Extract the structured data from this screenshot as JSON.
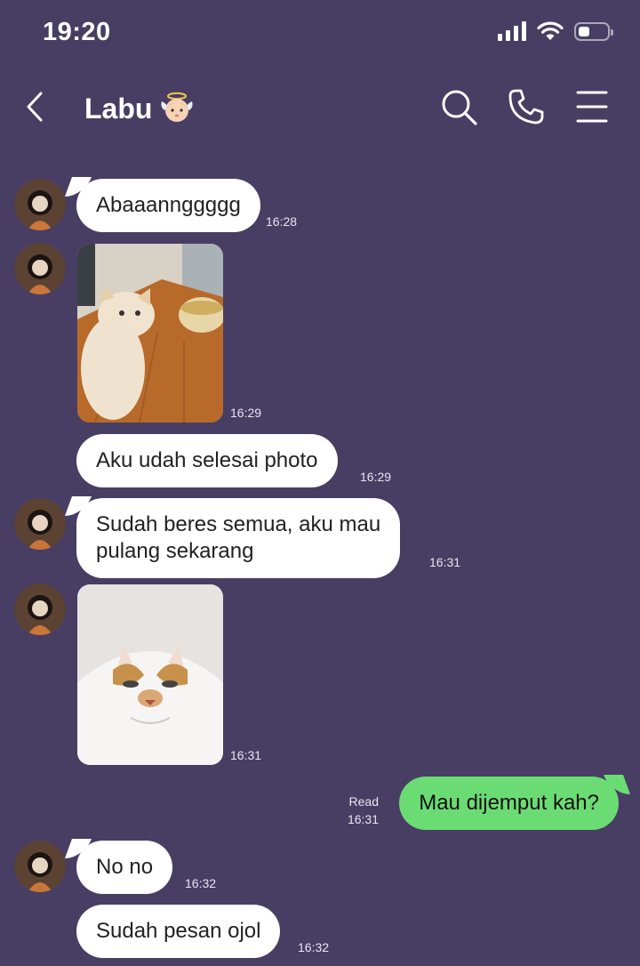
{
  "status": {
    "time": "19:20",
    "battery_level": 0.4
  },
  "header": {
    "title": "Labu",
    "title_emoji": "angel-baby-emoji"
  },
  "messages": [
    {
      "text": "Abaaannggggg",
      "time": "16:28"
    },
    {
      "type": "photo",
      "subject": "cat-on-table",
      "time": "16:29"
    },
    {
      "text": "Aku udah selesai photo",
      "time": "16:29"
    },
    {
      "line1": "Sudah beres semua, aku mau",
      "line2": "pulang sekarang",
      "time": "16:31"
    },
    {
      "type": "photo",
      "subject": "cat-closeup",
      "time": "16:31"
    },
    {
      "text": "Mau dijemput kah?",
      "time": "16:31",
      "read_label": "Read",
      "mine": true
    },
    {
      "text": "No no",
      "time": "16:32"
    },
    {
      "text": "Sudah pesan ojol",
      "time": "16:32"
    }
  ],
  "colors": {
    "background": "#483e63",
    "incoming": "#ffffff",
    "outgoing": "#6bdc74"
  }
}
